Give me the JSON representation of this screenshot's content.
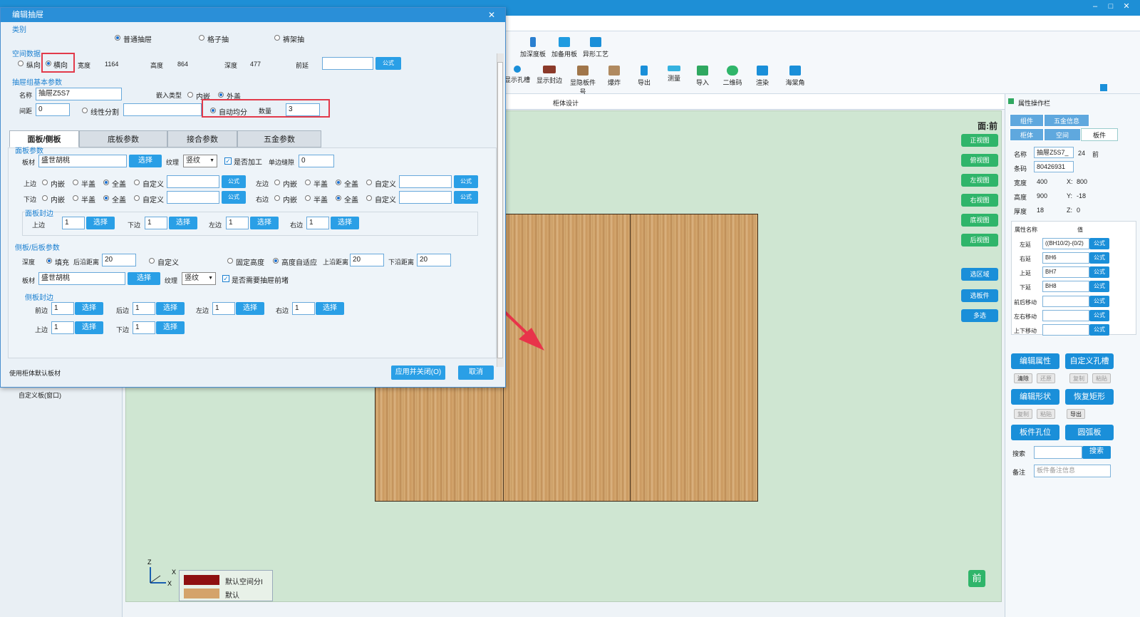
{
  "app": {
    "window_controls": [
      "–",
      "□",
      "✕"
    ]
  },
  "toolbar": {
    "top_items": [
      {
        "label": "加深度板",
        "color": "#2a7fd0"
      },
      {
        "label": "加备用板",
        "color": "#1f9be0"
      },
      {
        "label": "异形工艺",
        "color": "#1a8fd9"
      }
    ],
    "partial_left": "板",
    "items": [
      {
        "label": "显示孔槽",
        "color": "#1a8fd9"
      },
      {
        "label": "显示封边",
        "color": "#8b3a2a"
      },
      {
        "label": "显隐板件号",
        "color": "#a0764a"
      },
      {
        "label": "爆炸",
        "color": "#b08a60"
      },
      {
        "label": "导出",
        "color": "#1a8fd9"
      },
      {
        "label": "测量",
        "color": "#35b2e0"
      },
      {
        "label": "导入",
        "color": "#2fa860"
      },
      {
        "label": "二维码",
        "color": "#2fb56a"
      },
      {
        "label": "渲染",
        "color": "#1a8fd9"
      },
      {
        "label": "海棠角",
        "color": "#1a8fd9"
      }
    ]
  },
  "left_panel": {
    "item": "自定义板(窗口)"
  },
  "canvas": {
    "tab_label": "柜体设计",
    "view_label": "面:前",
    "view_buttons": [
      "正视图",
      "俯视图",
      "左视图",
      "右视图",
      "底视图",
      "后视图"
    ],
    "action_buttons": [
      "选区域",
      "选板件",
      "多选"
    ],
    "legend": [
      {
        "label": "默认空间分I",
        "color": "#8e1010"
      },
      {
        "label": "默认",
        "color": "#d4a36a"
      }
    ],
    "axis": {
      "z": "Z",
      "x": "X",
      "x2": "X"
    },
    "front_badge": "前"
  },
  "right_panel": {
    "title": "属性操作栏",
    "tabs_row1": [
      "组件",
      "五金信息"
    ],
    "tabs_row2": [
      "柜体",
      "空间",
      "板件"
    ],
    "name_label": "名称",
    "name_value": "抽屉Z5S7_",
    "thickness_tag": "24",
    "side_tag": "前",
    "code_label": "条码",
    "code_value": "80426931",
    "width_label": "宽度",
    "width_value": "400",
    "x_label": "X:",
    "x_value": "800",
    "height_label": "高度",
    "height_value": "900",
    "y_label": "Y:",
    "y_value": "-18",
    "thick_label": "厚度",
    "thick_value": "18",
    "z_label": "Z:",
    "z_value": "0",
    "attr_header": "属性名称",
    "value_header": "值",
    "attrs": [
      {
        "name": "左延",
        "value": "((BH10/2)-(0/2)"
      },
      {
        "name": "右延",
        "value": "BH6"
      },
      {
        "name": "上延",
        "value": "BH7"
      },
      {
        "name": "下延",
        "value": "BH8"
      },
      {
        "name": "前后移动",
        "value": ""
      },
      {
        "name": "左右移动",
        "value": ""
      },
      {
        "name": "上下移动",
        "value": ""
      }
    ],
    "formula_btn": "公式",
    "btn_edit_attr": "编辑属性",
    "btn_custom_hole": "自定义孔槽",
    "sm_row1": [
      "清除",
      "还原",
      "复制",
      "粘贴"
    ],
    "btn_edit_shape": "编辑形状",
    "btn_restore_rect": "恢复矩形",
    "sm_row2": [
      "复制",
      "粘贴",
      "导出"
    ],
    "btn_hole_pos": "板件孔位",
    "btn_arc": "圆弧板",
    "search_label": "搜索",
    "search_btn": "搜索",
    "note_label": "备注",
    "note_placeholder": "板件备注信息"
  },
  "dialog": {
    "title": "编辑抽屉",
    "close": "✕",
    "category_label": "类别",
    "category_options": [
      "普通抽屉",
      "格子抽",
      "裤架抽"
    ],
    "space_label": "空间数据",
    "orient_v": "纵向",
    "orient_h": "横向",
    "width_label": "宽度",
    "width": "1164",
    "height_label": "高度",
    "height": "864",
    "depth_label": "深度",
    "depth": "477",
    "front_ext_label": "前延",
    "front_ext": "",
    "formula": "公式",
    "basic_label": "抽屉组基本参数",
    "name_label": "名称",
    "name": "抽屉Z5S7",
    "embed_label": "嵌入类型",
    "embed_in": "内嵌",
    "embed_out": "外盖",
    "gap_label": "间距",
    "gap": "0",
    "linear_split": "线性分割",
    "linear_value": "",
    "auto_split": "自动均分",
    "count_label": "数量",
    "count": "3",
    "tabs": [
      "面板/侧板",
      "底板参数",
      "接合参数",
      "五金参数"
    ],
    "panel_section": "面板参数",
    "board_label": "板材",
    "board": "盛世胡桃",
    "select": "选择",
    "grain_label": "纹理",
    "grain": "竖纹",
    "process_label": "是否加工",
    "single_gap_label": "单边缝隙",
    "single_gap": "0",
    "top_edge": "上边",
    "bottom_edge": "下边",
    "left_edge": "左边",
    "right_edge": "右边",
    "opt_inset": "内嵌",
    "opt_half": "半盖",
    "opt_full": "全盖",
    "opt_custom": "自定义",
    "panel_seal": "面板封边",
    "seal_top": "上边",
    "seal_bottom": "下边",
    "seal_left": "左边",
    "seal_right": "右边",
    "seal_val": "1",
    "side_section": "侧板/后板参数",
    "depth2_label": "深度",
    "fill": "填充",
    "back_dist_label": "后沿距离",
    "back_dist": "20",
    "custom": "自定义",
    "fixed_h": "固定高度",
    "adapt_h": "高度自适应",
    "top_dist_label": "上沿距离",
    "top_dist": "20",
    "bot_dist_label": "下沿距离",
    "bot_dist": "20",
    "side_board": "盛世胡桃",
    "side_grain": "竖纹",
    "need_front": "是否需要抽屉前堵",
    "side_seal": "侧板封边",
    "s_front": "前边",
    "s_back": "后边",
    "s_left": "左边",
    "s_right": "右边",
    "s_top": "上边",
    "s_bottom": "下边",
    "footer_note": "使用柜体默认板材",
    "apply": "应用并关闭(O)",
    "cancel": "取消"
  }
}
